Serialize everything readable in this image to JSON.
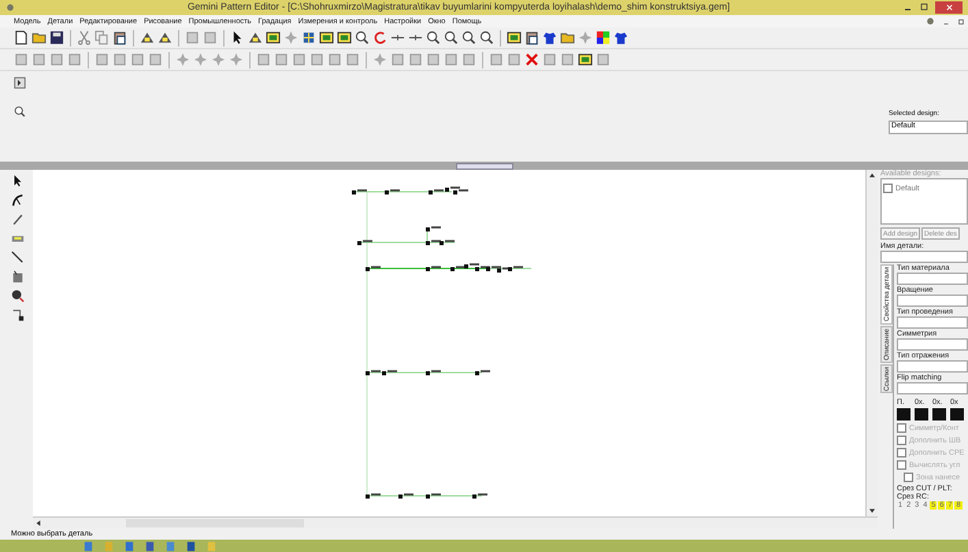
{
  "window": {
    "title": "Gemini Pattern Editor - [C:\\Shohruxmirzo\\Magistratura\\tikav buyumlarini kompyuterda loyihalash\\demo_shim konstruktsiya.gem]"
  },
  "menu": [
    "Модель",
    "Детали",
    "Редактирование",
    "Рисование",
    "Промышленность",
    "Градация",
    "Измерения и контроль",
    "Настройки",
    "Окно",
    "Помощь"
  ],
  "top_panel": {
    "selected_design_label": "Selected design:",
    "selected_design": "Default"
  },
  "properties": {
    "available_label": "Available designs:",
    "designs": [
      {
        "label": "Default",
        "checked": false
      }
    ],
    "buttons": [
      "Add design",
      "Delete des"
    ],
    "piece_name_label": "Имя детали:",
    "tabs": [
      {
        "label": "Свойства детали",
        "selected": true
      },
      {
        "label": "Описание",
        "selected": false
      },
      {
        "label": "Ссылки",
        "selected": false
      }
    ],
    "fields": [
      "Тип материала",
      "Вращение",
      "Тип проведения",
      "Симметрия",
      "Тип отражения",
      "Flip matching"
    ],
    "swatches": [
      "П.",
      "0х.",
      "0х.",
      "0х"
    ],
    "checks": [
      {
        "label": "Симметр/Конт",
        "checked": false,
        "disabled": true
      },
      {
        "label": "Дополнить ШВ",
        "checked": false,
        "disabled": true
      },
      {
        "label": "Дополнить СРЕ",
        "checked": false,
        "disabled": true
      },
      {
        "label": "Вычислять угл",
        "checked": false,
        "disabled": true,
        "children": [
          {
            "label": "Зона нанесе",
            "checked": false,
            "disabled": true
          }
        ]
      }
    ],
    "cut_label": "Срез CUT / PLT:",
    "rc_label": "Срез RC:",
    "digits": [
      {
        "label": "1",
        "highlighted": false
      },
      {
        "label": "2",
        "highlighted": false
      },
      {
        "label": "3",
        "highlighted": false
      },
      {
        "label": "4",
        "highlighted": false
      },
      {
        "label": "5",
        "highlighted": true
      },
      {
        "label": "6",
        "highlighted": true
      },
      {
        "label": "7",
        "highlighted": true
      },
      {
        "label": "8",
        "highlighted": true
      }
    ]
  },
  "status_bar": "Можно выбрать деталь"
}
